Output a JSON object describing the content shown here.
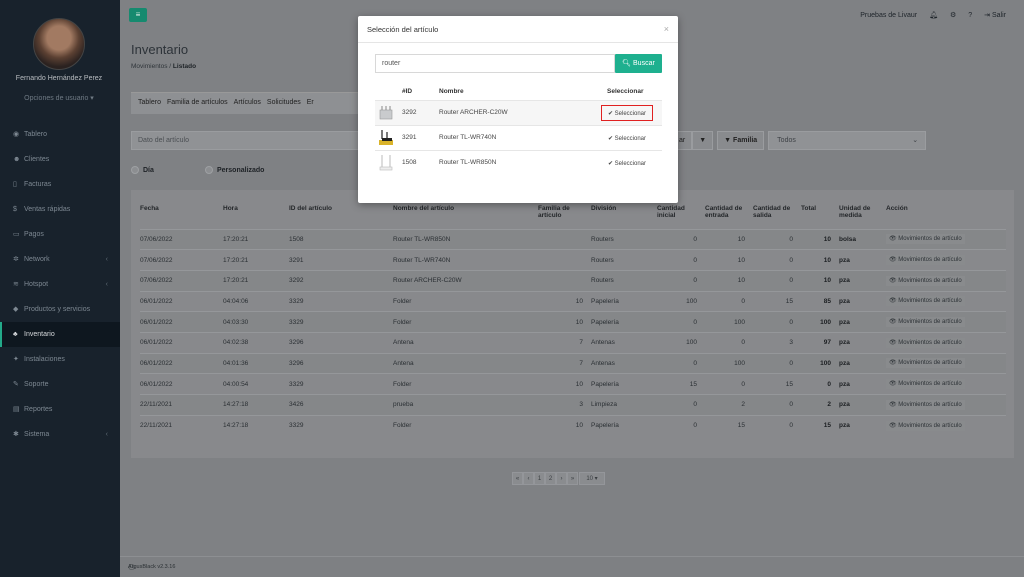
{
  "sidebar": {
    "user_name": "Fernando Hernández Perez",
    "user_options": "Opciones de usuario ▾",
    "items": [
      {
        "icon": "tachometer-icon",
        "glyph": "◉",
        "label": "Tablero",
        "chev": ""
      },
      {
        "icon": "users-icon",
        "glyph": "☻",
        "label": "Clientes",
        "chev": ""
      },
      {
        "icon": "file-icon",
        "glyph": "▯",
        "label": "Facturas",
        "chev": ""
      },
      {
        "icon": "dollar-icon",
        "glyph": "$",
        "label": "Ventas rápidas",
        "chev": ""
      },
      {
        "icon": "money-icon",
        "glyph": "▭",
        "label": "Pagos",
        "chev": ""
      },
      {
        "icon": "network-icon",
        "glyph": "✲",
        "label": "Network",
        "chev": "‹"
      },
      {
        "icon": "wifi-icon",
        "glyph": "≋",
        "label": "Hotspot",
        "chev": "‹"
      },
      {
        "icon": "tag-icon",
        "glyph": "◆",
        "label": "Productos y servicios",
        "chev": ""
      },
      {
        "icon": "cubes-icon",
        "glyph": "♣",
        "label": "Inventario",
        "chev": ""
      },
      {
        "icon": "plug-icon",
        "glyph": "✦",
        "label": "Instalaciones",
        "chev": ""
      },
      {
        "icon": "wrench-icon",
        "glyph": "✎",
        "label": "Soporte",
        "chev": ""
      },
      {
        "icon": "chart-icon",
        "glyph": "▤",
        "label": "Reportes",
        "chev": ""
      },
      {
        "icon": "cogs-icon",
        "glyph": "✱",
        "label": "Sistema",
        "chev": "‹"
      }
    ],
    "active_index": 8
  },
  "topbar": {
    "menu_glyph": "≡",
    "user": "Pruebas de Livaur",
    "logout": "Salir"
  },
  "page": {
    "title": "Inventario",
    "crumb_parent": "Movimientos",
    "crumb_sep": "/",
    "crumb_current": "Listado"
  },
  "tabs": [
    "Tablero",
    "Familia de artículos",
    "Artículos",
    "Solicitudes",
    "Er"
  ],
  "filters": {
    "article_placeholder": "Dato del artículo",
    "ar_label": "ar",
    "family_label": "Familia",
    "family_value": "Todos",
    "radio_day": "Día",
    "radio_custom": "Personalizado"
  },
  "table": {
    "headers": [
      "Fecha",
      "Hora",
      "ID del artículo",
      "Nombre del artículo",
      "Familia de artículo",
      "División",
      "Cantidad inicial",
      "Cantidad de entrada",
      "Cantidad de salida",
      "Total",
      "Unidad de medida",
      "Acción"
    ],
    "action_label": "Movimientos de artículo",
    "rows": [
      [
        "07/06/2022",
        "17:20:21",
        "1508",
        "Router TL-WR850N",
        "",
        "Routers",
        "0",
        "10",
        "0",
        "10",
        "bolsa"
      ],
      [
        "07/06/2022",
        "17:20:21",
        "3291",
        "Router TL-WR740N",
        "",
        "Routers",
        "0",
        "10",
        "0",
        "10",
        "pza"
      ],
      [
        "07/06/2022",
        "17:20:21",
        "3292",
        "Router ARCHER-C20W",
        "",
        "Routers",
        "0",
        "10",
        "0",
        "10",
        "pza"
      ],
      [
        "06/01/2022",
        "04:04:06",
        "3329",
        "Folder",
        "10",
        "Papelería",
        "100",
        "0",
        "15",
        "85",
        "pza"
      ],
      [
        "06/01/2022",
        "04:03:30",
        "3329",
        "Folder",
        "10",
        "Papelería",
        "0",
        "100",
        "0",
        "100",
        "pza"
      ],
      [
        "06/01/2022",
        "04:02:38",
        "3296",
        "Antena",
        "7",
        "Antenas",
        "100",
        "0",
        "3",
        "97",
        "pza"
      ],
      [
        "06/01/2022",
        "04:01:36",
        "3296",
        "Antena",
        "7",
        "Antenas",
        "0",
        "100",
        "0",
        "100",
        "pza"
      ],
      [
        "06/01/2022",
        "04:00:54",
        "3329",
        "Folder",
        "10",
        "Papelería",
        "15",
        "0",
        "15",
        "0",
        "pza"
      ],
      [
        "22/11/2021",
        "14:27:18",
        "3426",
        "prueba",
        "3",
        "Limpieza",
        "0",
        "2",
        "0",
        "2",
        "pza"
      ],
      [
        "22/11/2021",
        "14:27:18",
        "3329",
        "Folder",
        "10",
        "Papelería",
        "0",
        "15",
        "0",
        "15",
        "pza"
      ]
    ]
  },
  "pager": [
    "«",
    "‹",
    "1",
    "2",
    "›",
    "»",
    "10 ▾"
  ],
  "footer": {
    "version": "ArgusBlack v2.3.16"
  },
  "modal": {
    "title": "Selección del artículo",
    "close": "×",
    "search_value": "router",
    "search_button": "Buscar",
    "headers": [
      "",
      "#ID",
      "Nombre",
      "Seleccionar"
    ],
    "select_label": "✔ Seleccionar",
    "rows": [
      {
        "id": "3292",
        "name": "Router ARCHER-C20W",
        "thumb": "router-archer-thumbnail"
      },
      {
        "id": "3291",
        "name": "Router TL-WR740N",
        "thumb": "router-tlwr740n-thumbnail"
      },
      {
        "id": "1508",
        "name": "Router TL-WR850N",
        "thumb": "router-tlwr850n-thumbnail"
      }
    ]
  },
  "colors": {
    "accent": "#1eb08f",
    "sidebar": "#18222c",
    "highlight": "#e02020"
  }
}
